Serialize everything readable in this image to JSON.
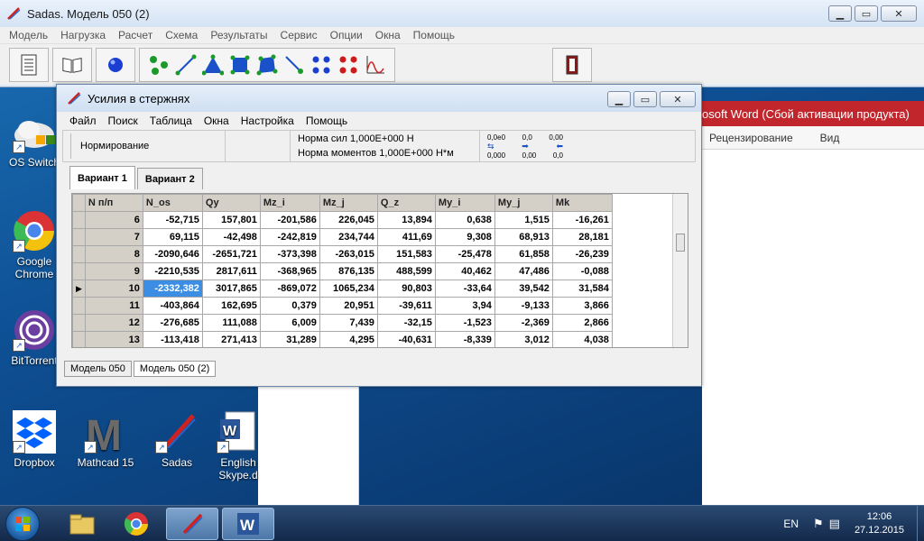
{
  "main_window": {
    "title": "Sadas. Модель 050 (2)",
    "menu": [
      "Модель",
      "Нагрузка",
      "Расчет",
      "Схема",
      "Результаты",
      "Сервис",
      "Опции",
      "Окна",
      "Помощь"
    ],
    "buttons": {
      "minimize": "▁",
      "maximize": "▭",
      "close": "✕"
    }
  },
  "word_window": {
    "title": "osoft Word (Сбой активации продукта)",
    "ribbon_tabs": [
      "Рецензирование",
      "Вид"
    ]
  },
  "desktop_icons": [
    {
      "label": "OS Switch",
      "icon": "os-switch-icon"
    },
    {
      "label": "Google Chrome",
      "icon": "chrome-icon"
    },
    {
      "label": "BitTorrent",
      "icon": "bittorrent-icon"
    },
    {
      "label": "Dropbox",
      "icon": "dropbox-icon"
    },
    {
      "label": "Mathcad 15",
      "icon": "mathcad-icon"
    },
    {
      "label": "Sadas",
      "icon": "sadas-icon"
    },
    {
      "label": "English Skype.d",
      "icon": "word-doc-icon"
    }
  ],
  "child_window": {
    "title": "Усилия в стержнях",
    "menu": [
      "Файл",
      "Поиск",
      "Таблица",
      "Окна",
      "Настройка",
      "Помощь"
    ],
    "norm_button": "Нормирование",
    "norm_force": "Норма сил 1,000E+000 Н",
    "norm_moment": "Норма моментов 1,000E+000 Н*м",
    "format_labels": [
      "0,0e0",
      "0,0",
      "0,00",
      "0,000",
      "0,00",
      "0,0"
    ],
    "tabs": [
      "Вариант 1",
      "Вариант 2"
    ],
    "bottom_tabs": [
      "Модель 050",
      "Модель 050 (2)"
    ]
  },
  "table": {
    "headers": [
      "N п/п",
      "N_os",
      "Qy",
      "Mz_i",
      "Mz_j",
      "Q_z",
      "My_i",
      "My_j",
      "Mk"
    ],
    "rows": [
      [
        "6",
        "-52,715",
        "157,801",
        "-201,586",
        "226,045",
        "13,894",
        "0,638",
        "1,515",
        "-16,261"
      ],
      [
        "7",
        "69,115",
        "-42,498",
        "-242,819",
        "234,744",
        "411,69",
        "9,308",
        "68,913",
        "28,181"
      ],
      [
        "8",
        "-2090,646",
        "-2651,721",
        "-373,398",
        "-263,015",
        "151,583",
        "-25,478",
        "61,858",
        "-26,239"
      ],
      [
        "9",
        "-2210,535",
        "2817,611",
        "-368,965",
        "876,135",
        "488,599",
        "40,462",
        "47,486",
        "-0,088"
      ],
      [
        "10",
        "-2332,382",
        "3017,865",
        "-869,072",
        "1065,234",
        "90,803",
        "-33,64",
        "39,542",
        "31,584"
      ],
      [
        "11",
        "-403,864",
        "162,695",
        "0,379",
        "20,951",
        "-39,611",
        "3,94",
        "-9,133",
        "3,866"
      ],
      [
        "12",
        "-276,685",
        "111,088",
        "6,009",
        "7,439",
        "-32,15",
        "-1,523",
        "-2,369",
        "2,866"
      ],
      [
        "13",
        "-113,418",
        "271,413",
        "31,289",
        "4,295",
        "-40,631",
        "-8,339",
        "3,012",
        "4,038"
      ]
    ]
  },
  "taskbar": {
    "lang": "EN",
    "time": "12:06",
    "date": "27.12.2015"
  }
}
